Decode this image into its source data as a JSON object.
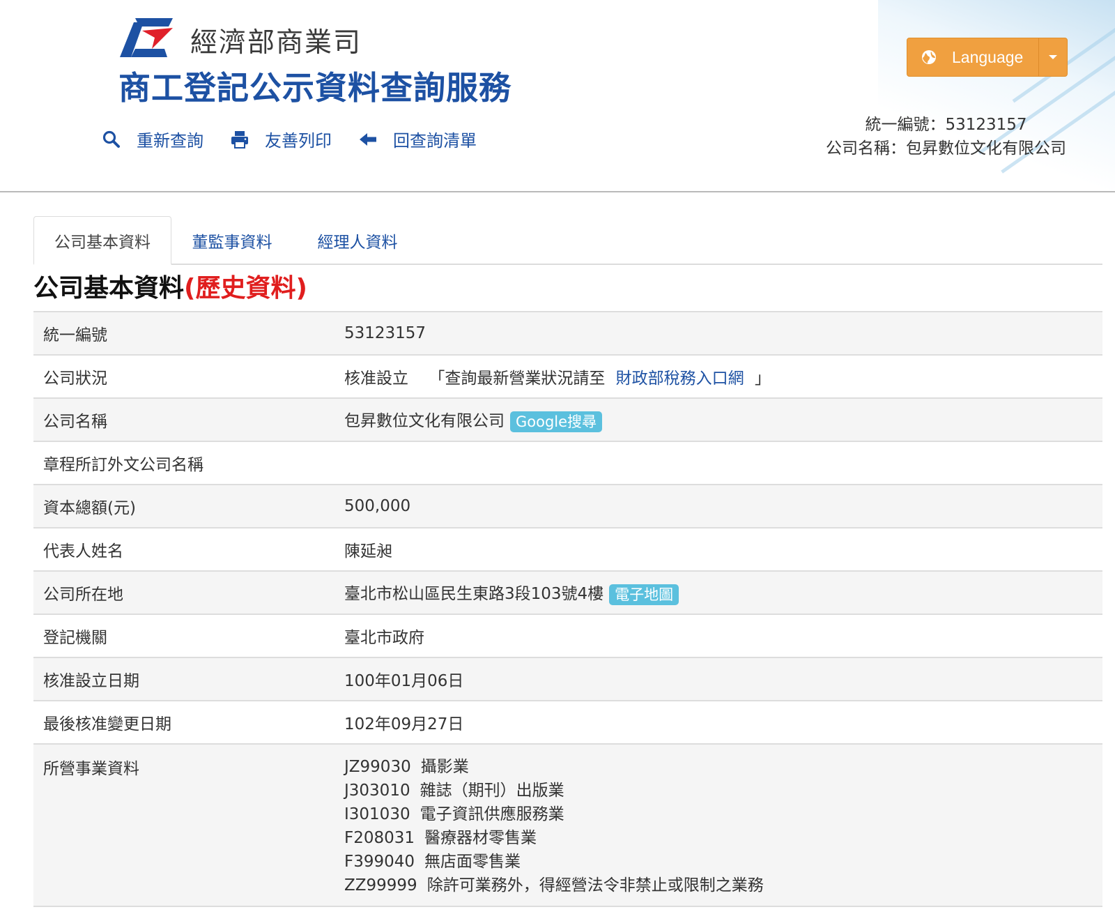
{
  "header": {
    "ministry": "經濟部商業司",
    "service_title": "商工登記公示資料查詢服務",
    "nav": [
      {
        "label": "重新查詢",
        "icon": "search-icon"
      },
      {
        "label": "友善列印",
        "icon": "print-icon"
      },
      {
        "label": "回查詢清單",
        "icon": "arrow-left-icon"
      }
    ],
    "language_label": "Language",
    "summary_id": "統一編號：53123157",
    "summary_name": "公司名稱：包昇數位文化有限公司",
    "colors": {
      "brand_blue": "#1d51a3",
      "accent_orange": "#f0a040",
      "logo_red": "#e0202a"
    }
  },
  "tabs": [
    {
      "label": "公司基本資料",
      "active": true
    },
    {
      "label": "董監事資料",
      "active": false
    },
    {
      "label": "經理人資料",
      "active": false
    }
  ],
  "section": {
    "title": "公司基本資料",
    "history": "(歷史資料)"
  },
  "table": {
    "uid": {
      "key": "統一編號",
      "value": "53123157"
    },
    "status": {
      "key": "公司狀況",
      "value": "核准設立",
      "note_prefix": "「查詢最新營業狀況請至",
      "link": "財政部稅務入口網",
      "note_suffix": "」"
    },
    "name": {
      "key": "公司名稱",
      "value": "包昇數位文化有限公司",
      "badge": "Google搜尋"
    },
    "foreign_name": {
      "key": "章程所訂外文公司名稱",
      "value": ""
    },
    "capital": {
      "key": "資本總額(元)",
      "value": "500,000"
    },
    "representative": {
      "key": "代表人姓名",
      "value": "陳延昶"
    },
    "address": {
      "key": "公司所在地",
      "value": "臺北市松山區民生東路3段103號4樓",
      "badge": "電子地圖"
    },
    "authority": {
      "key": "登記機關",
      "value": "臺北市政府"
    },
    "established": {
      "key": "核准設立日期",
      "value": "100年01月06日"
    },
    "last_change": {
      "key": "最後核准變更日期",
      "value": "102年09月27日"
    },
    "business": {
      "key": "所營事業資料",
      "items": [
        {
          "code": "JZ99030",
          "desc": "攝影業"
        },
        {
          "code": "J303010",
          "desc": "雜誌（期刊）出版業"
        },
        {
          "code": "I301030",
          "desc": "電子資訊供應服務業"
        },
        {
          "code": "F208031",
          "desc": "醫療器材零售業"
        },
        {
          "code": "F399040",
          "desc": "無店面零售業"
        },
        {
          "code": "ZZ99999",
          "desc": "除許可業務外，得經營法令非禁止或限制之業務"
        }
      ]
    }
  }
}
